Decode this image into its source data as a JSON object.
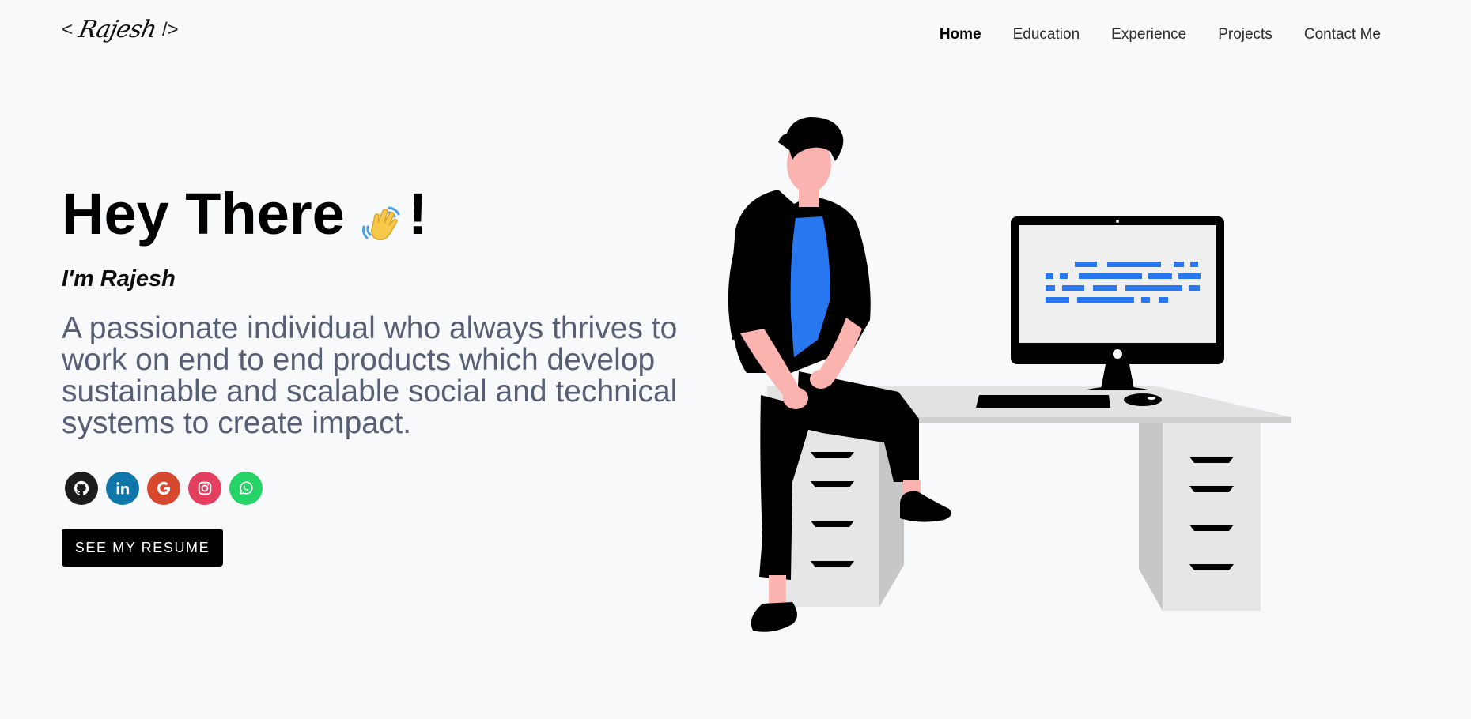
{
  "header": {
    "logo": {
      "open_bracket": "<",
      "signature": "Rajesh",
      "close_bracket": "/>"
    },
    "nav": [
      {
        "label": "Home",
        "active": true
      },
      {
        "label": "Education",
        "active": false
      },
      {
        "label": "Experience",
        "active": false
      },
      {
        "label": "Projects",
        "active": false
      },
      {
        "label": "Contact Me",
        "active": false
      }
    ]
  },
  "hero": {
    "title": "Hey There",
    "title_suffix": "!",
    "wave_icon": "waving-hand-icon",
    "subtitle": "I'm Rajesh",
    "description": "A passionate individual who always thrives to work on end to end products which develop sustainable and scalable social and technical systems to create impact."
  },
  "socials": [
    {
      "name": "github",
      "icon": "github-icon",
      "color": "#1c1c1c"
    },
    {
      "name": "linkedin",
      "icon": "linkedin-icon",
      "color": "#0e76a8"
    },
    {
      "name": "google",
      "icon": "google-icon",
      "color": "#d7482f"
    },
    {
      "name": "instagram",
      "icon": "instagram-icon",
      "color": "#e3405f"
    },
    {
      "name": "whatsapp",
      "icon": "whatsapp-icon",
      "color": "#25d366"
    }
  ],
  "resume_button": {
    "label": "SEE MY RESUME"
  },
  "colors": {
    "background": "#f8f9fb",
    "text_primary": "#000000",
    "text_secondary": "#575f75",
    "accent_blue": "#2677f0",
    "skin": "#fbb3b0"
  }
}
